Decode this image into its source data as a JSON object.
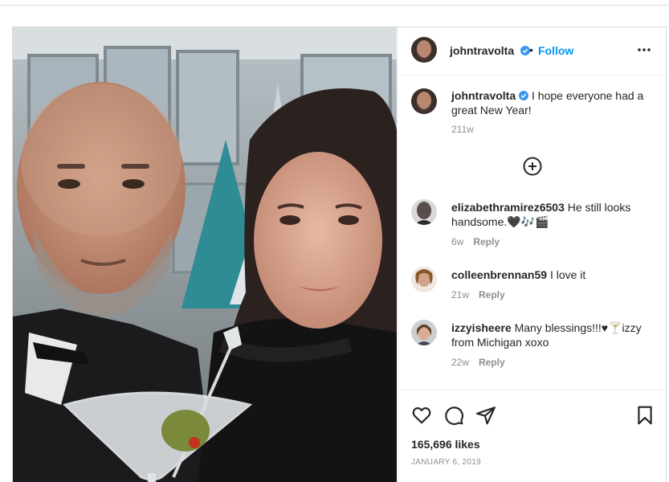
{
  "post": {
    "author": {
      "username": "johntravolta",
      "verified": true,
      "avatar": "profile-photo"
    },
    "header": {
      "separator": "•",
      "follow_label": "Follow",
      "more_icon": "more-options-icon"
    },
    "caption": {
      "username": "johntravolta",
      "text": "I hope everyone had a great New Year!",
      "time": "211w"
    },
    "load_more_icon": "plus-circle-icon",
    "comments": [
      {
        "username": "elizabethramirez6503",
        "text": "He still looks handsome.🖤🎶🎬",
        "time": "6w",
        "reply_label": "Reply"
      },
      {
        "username": "colleenbrennan59",
        "text": "I love it",
        "time": "21w",
        "reply_label": "Reply"
      },
      {
        "username": "izzyisheere",
        "text": "Many blessings!!!♥🍸izzy from Michigan xoxo",
        "time": "22w",
        "reply_label": "Reply"
      }
    ],
    "actions": [
      "heart-icon",
      "comment-icon",
      "share-icon",
      "bookmark-icon"
    ],
    "likes": "165,696 likes",
    "date": "JANUARY 6, 2019"
  },
  "colors": {
    "link": "#0095f6",
    "verified": "#3897f0",
    "secondary_text": "#8e8e8e",
    "border": "#dbdbdb"
  }
}
